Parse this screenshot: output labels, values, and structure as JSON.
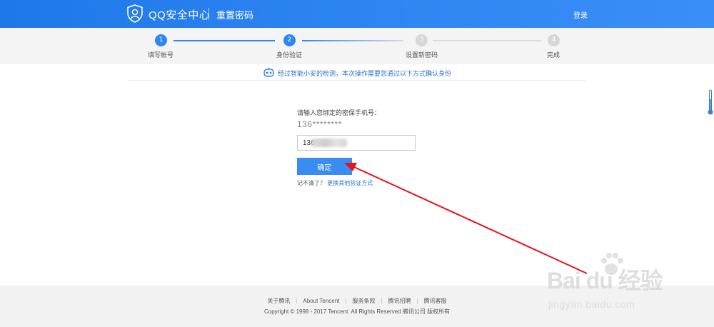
{
  "header": {
    "brand": "QQ安全中心",
    "page_name": "重置密码",
    "login_label": "登录"
  },
  "steps": [
    {
      "number": "1",
      "label": "填写帐号",
      "state": "done"
    },
    {
      "number": "2",
      "label": "身份验证",
      "state": "active"
    },
    {
      "number": "3",
      "label": "设置新密码",
      "state": "pending"
    },
    {
      "number": "4",
      "label": "完成",
      "state": "pending"
    }
  ],
  "notice": {
    "text": "经过智能小安的检测，本次操作需要您通过以下方式确认身份"
  },
  "form": {
    "prompt": "请输入您绑定的密保手机号：",
    "masked_phone": "136********",
    "phone_value": "136",
    "confirm_label": "确定",
    "forgot_text": "记不清了？",
    "alt_method_label": "更换其他验证方式"
  },
  "footer": {
    "links": [
      "关于腾讯",
      "About Tencent",
      "服务条款",
      "腾讯招聘",
      "腾讯客服"
    ],
    "copyright": "Copyright © 1998 - 2017 Tencent. All Rights Reserved 腾讯公司 版权所有"
  },
  "watermark": {
    "main": "Bai du 经验",
    "sub": "jingyan.baidu.com"
  },
  "colors": {
    "brand_blue": "#2f86f2",
    "annotation_red": "#e8141a",
    "link_blue": "#2f6fd0"
  }
}
